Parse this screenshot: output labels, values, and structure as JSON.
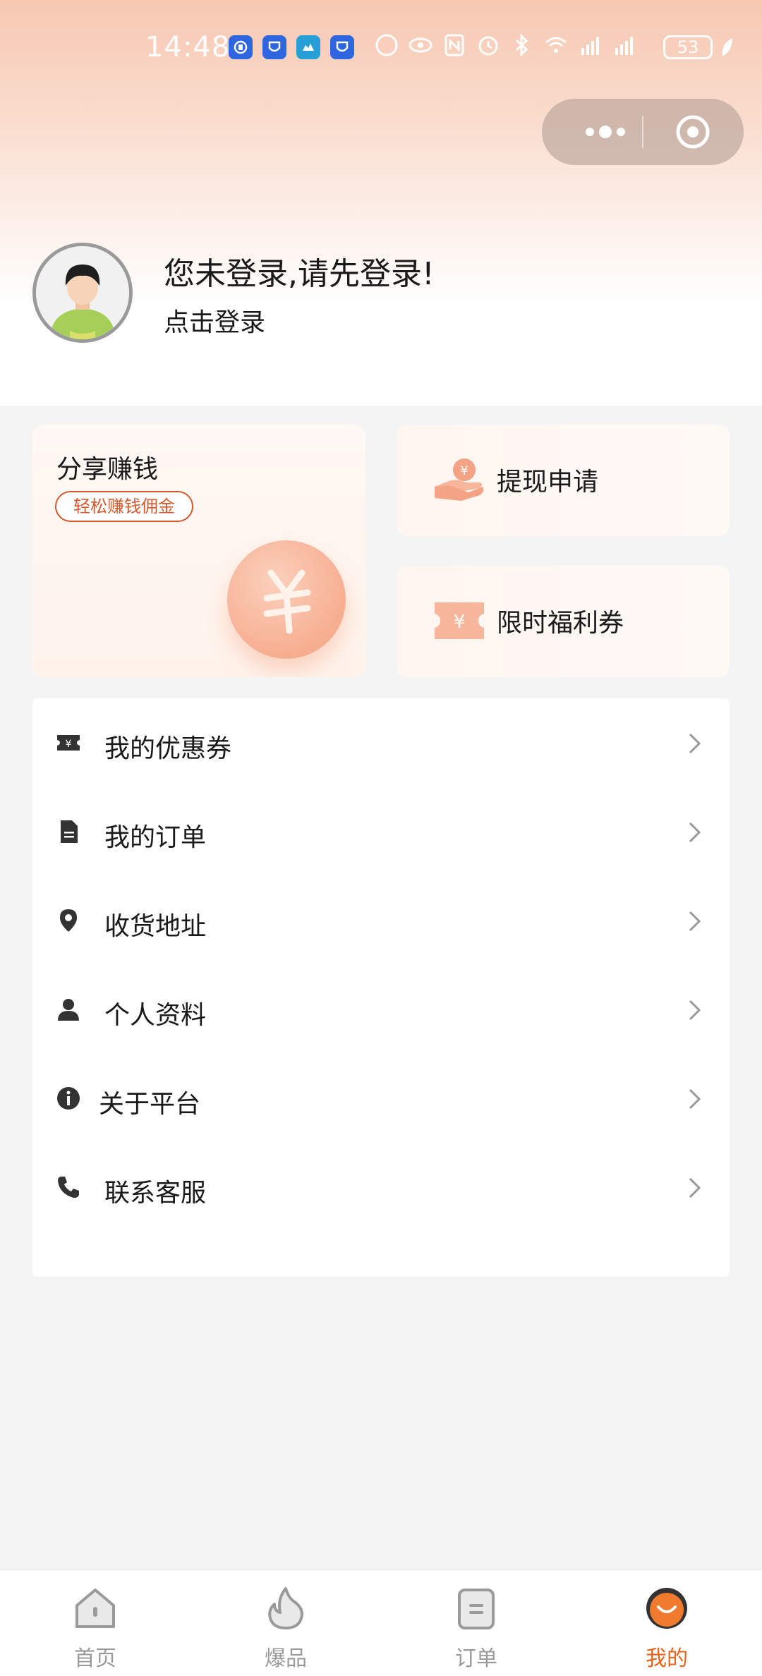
{
  "status_bar": {
    "time": "14:48",
    "battery": "53"
  },
  "profile": {
    "title": "您未登录,请先登录!",
    "login_link": "点击登录"
  },
  "cards": {
    "share": {
      "title": "分享赚钱",
      "tag": "轻松赚钱佣金"
    },
    "withdraw": {
      "label": "提现申请"
    },
    "coupon": {
      "label": "限时福利券"
    }
  },
  "menu": {
    "items": [
      {
        "label": "我的优惠券",
        "icon": "coupon-icon"
      },
      {
        "label": "我的订单",
        "icon": "document-icon"
      },
      {
        "label": "收货地址",
        "icon": "location-pin-icon"
      },
      {
        "label": "个人资料",
        "icon": "person-icon"
      },
      {
        "label": "关于平台",
        "icon": "info-icon"
      },
      {
        "label": "联系客服",
        "icon": "phone-icon"
      }
    ]
  },
  "tabbar": {
    "tabs": [
      {
        "label": "首页",
        "icon": "home-icon",
        "active": false
      },
      {
        "label": "爆品",
        "icon": "flame-icon",
        "active": false
      },
      {
        "label": "订单",
        "icon": "clipboard-icon",
        "active": false
      },
      {
        "label": "我的",
        "icon": "smile-icon",
        "active": true
      }
    ]
  },
  "colors": {
    "accent": "#e8621a",
    "tag_border": "#d4582c",
    "icon_coral": "#f4a384",
    "icon_dark": "#333333",
    "inactive": "#9a9a9a"
  }
}
